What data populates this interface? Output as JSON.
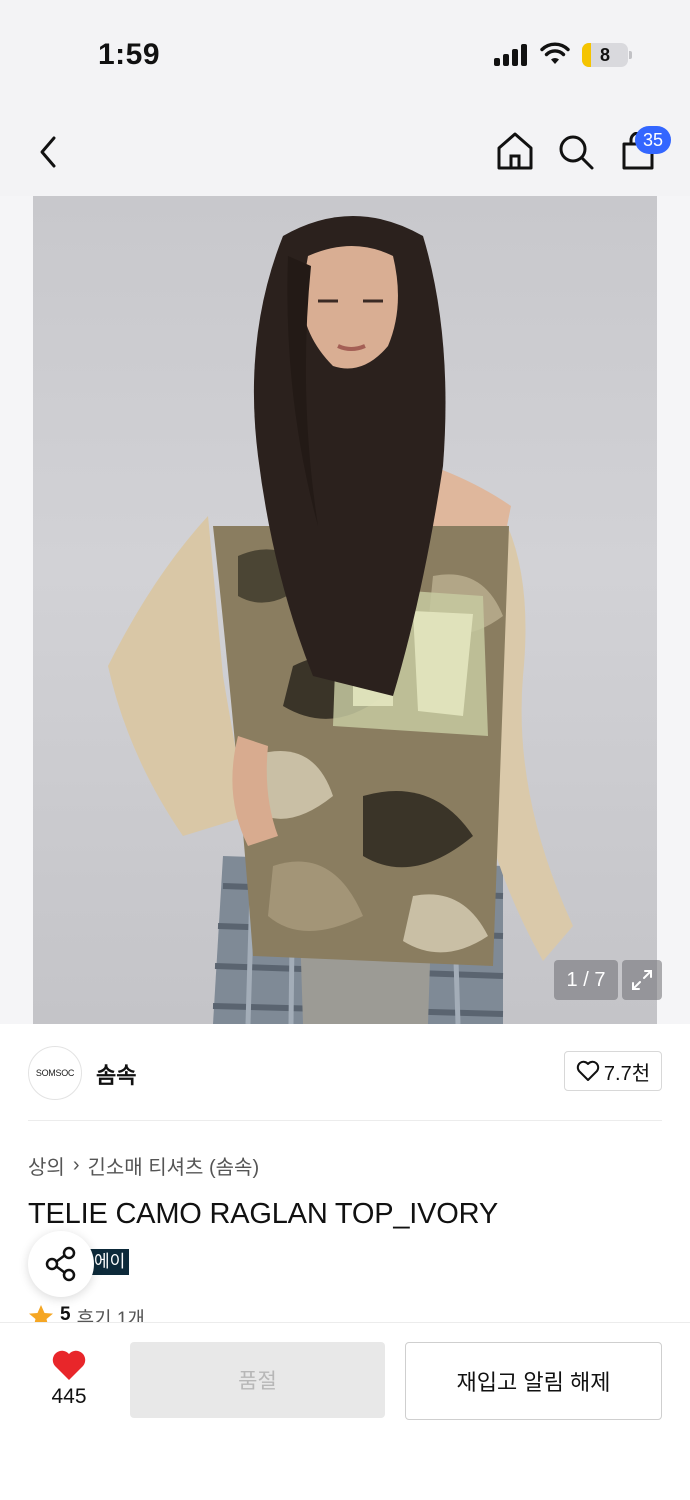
{
  "status_bar": {
    "time": "1:59",
    "battery_level": "8"
  },
  "nav": {
    "cart_count": "35"
  },
  "image": {
    "counter": "1 / 7"
  },
  "brand": {
    "logo_text": "SOMSOC",
    "name": "솜속",
    "like_count": "7.7천"
  },
  "breadcrumb": {
    "category": "상의",
    "separator": "›",
    "subcategory": "긴소매 티셔츠 (솜속)"
  },
  "product": {
    "title": "TELIE CAMO RAGLAN TOP_IVORY",
    "tag": "에이",
    "rating": "5",
    "review_text": "후기 1개"
  },
  "bottom_bar": {
    "heart_count": "445",
    "soldout_label": "품절",
    "restock_label": "재입고 알림 해제"
  },
  "colors": {
    "accent_blue": "#3366ff",
    "heart_red": "#e8262a",
    "tag_navy": "#0d2a3a",
    "star_orange": "#f5a623"
  },
  "icons": [
    "back-icon",
    "home-icon",
    "search-icon",
    "cart-icon",
    "expand-icon",
    "heart-outline-icon",
    "share-icon",
    "star-icon",
    "heart-filled-icon"
  ]
}
